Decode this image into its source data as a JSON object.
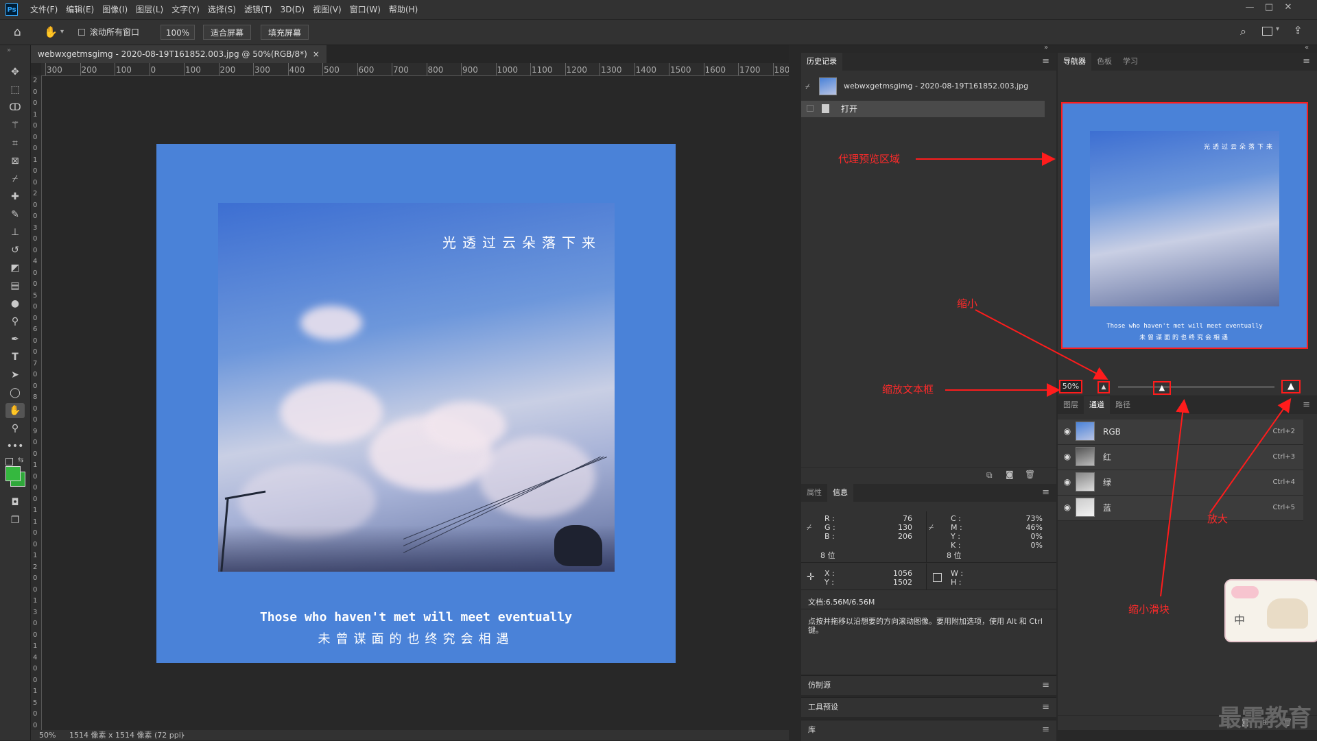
{
  "app": {
    "logo": "Ps",
    "menu": [
      "文件(F)",
      "编辑(E)",
      "图像(I)",
      "图层(L)",
      "文字(Y)",
      "选择(S)",
      "滤镜(T)",
      "3D(D)",
      "视图(V)",
      "窗口(W)",
      "帮助(H)"
    ],
    "window_controls": [
      "—",
      "□",
      "✕"
    ]
  },
  "options_bar": {
    "scroll_all_label": "滚动所有窗口",
    "zoom_btn": "100%",
    "fit_screen_btn": "适合屏幕",
    "fill_screen_btn": "填充屏幕"
  },
  "document": {
    "tab_title": "webwxgetmsgimg - 2020-08-19T161852.003.jpg @ 50%(RGB/8*)",
    "tab_close": "×",
    "ruler_h": [
      "300",
      "200",
      "100",
      "0",
      "100",
      "200",
      "300",
      "400",
      "500",
      "600",
      "700",
      "800",
      "900",
      "1000",
      "1100",
      "1200",
      "1300",
      "1400",
      "1500",
      "1600",
      "1700",
      "180"
    ],
    "ruler_v": [
      "2",
      "0",
      "0",
      "1",
      "0",
      "0",
      "0",
      "1",
      "0",
      "0",
      "2",
      "0",
      "0",
      "3",
      "0",
      "0",
      "4",
      "0",
      "0",
      "5",
      "0",
      "0",
      "6",
      "0",
      "0",
      "7",
      "0",
      "0",
      "8",
      "0",
      "0",
      "9",
      "0",
      "0",
      "1",
      "0",
      "0",
      "0",
      "1",
      "1",
      "0",
      "0",
      "1",
      "2",
      "0",
      "0",
      "1",
      "3",
      "0",
      "0",
      "1",
      "4",
      "0",
      "0",
      "1",
      "5",
      "0",
      "0"
    ],
    "artwork_title": "光透过云朵落下来",
    "artwork_en": "Those who haven't met will meet eventually",
    "artwork_cn": "未曾谋面的也终究会相遇",
    "status_zoom": "50%",
    "status_info": "1514 像素 x 1514 像素 (72 ppi)",
    "status_arrow": "›"
  },
  "history_panel": {
    "tab": "历史记录",
    "snapshot_name": "webwxgetmsgimg - 2020-08-19T161852.003.jpg",
    "step_open": "打开"
  },
  "info_panel": {
    "tabs": [
      "属性",
      "信息"
    ],
    "rgb": {
      "r_label": "R :",
      "g_label": "G :",
      "b_label": "B :",
      "r": "76",
      "g": "130",
      "b": "206",
      "bits": "8 位"
    },
    "cmyk": {
      "c_label": "C :",
      "m_label": "M :",
      "y_label": "Y :",
      "k_label": "K :",
      "c": "73%",
      "m": "46%",
      "y": "0%",
      "k": "0%",
      "bits": "8 位"
    },
    "xy": {
      "x_label": "X :",
      "y_label": "Y :",
      "x": "1056",
      "y": "1502"
    },
    "wh": {
      "w_label": "W :",
      "h_label": "H :"
    },
    "doc_size": "文档:6.56M/6.56M",
    "hint": "点按并拖移以沿想要的方向滚动图像。要用附加选项，使用 Alt 和 Ctrl 键。"
  },
  "collapsed_panels": [
    "仿制源",
    "工具预设",
    "库"
  ],
  "navigator_panel": {
    "tabs": [
      "导航器",
      "色板",
      "学习"
    ],
    "zoom_value": "50%",
    "thumb_title": "光透过云朵落下来",
    "thumb_en": "Those who haven't met will meet eventually",
    "thumb_cn": "未曾谋面的也终究会相遇",
    "slider_level": 0.28
  },
  "channels_panel": {
    "tabs": [
      "图层",
      "通道",
      "路径"
    ],
    "channels": [
      {
        "name": "RGB",
        "key": "Ctrl+2"
      },
      {
        "name": "红",
        "key": "Ctrl+3"
      },
      {
        "name": "绿",
        "key": "Ctrl+4"
      },
      {
        "name": "蓝",
        "key": "Ctrl+5"
      }
    ]
  },
  "annotations": {
    "proxy": "代理预览区域",
    "zoom_out": "缩小",
    "zoom_box": "缩放文本框",
    "zoom_in": "放大",
    "slider": "缩小滑块",
    "color": "#ff2a2a"
  },
  "watermark": "最需教育",
  "sticker_text": "中"
}
